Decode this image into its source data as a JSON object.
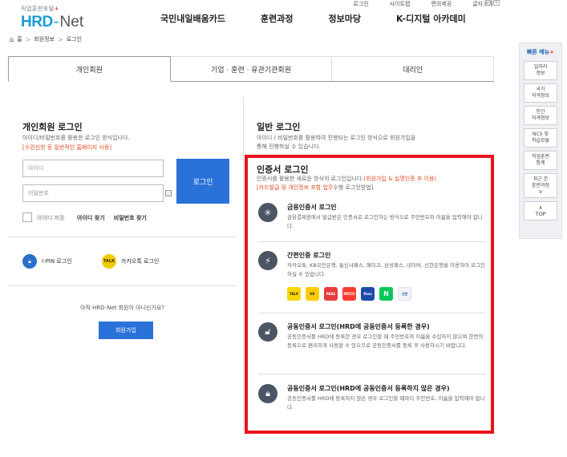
{
  "utility": {
    "links": [
      "로그인",
      "사이트맵",
      "편의제공",
      "글자크기"
    ],
    "font_minus": "-",
    "font_plus": "+"
  },
  "logo": {
    "sub": "직업훈련포털",
    "sub_plus": "+",
    "main_hrd": "HRD",
    "main_dash": "-",
    "main_net": "Net"
  },
  "gnb": [
    "국민내일배움카드",
    "훈련과정",
    "정보마당",
    "K-디지털 아카데미"
  ],
  "breadcrumb": {
    "home": "홈",
    "sep1": ">",
    "level1": "회원정보",
    "sep2": ">",
    "level2": "로그인"
  },
  "tabs": [
    "개인회원",
    "기업 · 훈련 · 유관기관회원",
    "대리인"
  ],
  "personal": {
    "title": "개인회원 로그인",
    "desc": "아이디/비밀번호를 활용한 로그인 방식입니다.",
    "note": "[수강신청 등 일반적인 홈페이지 사용]",
    "id_placeholder": "아이디",
    "pw_placeholder": "비밀번호",
    "login_button": "로그인",
    "save_id": "아이디 저장",
    "find_id": "아이디 찾기",
    "find_sep": "·",
    "find_pw": "비밀번호 찾기",
    "ipin": "I-PIN 로그인",
    "kakao": "카카오톡 로그인",
    "kakao_icon": "TALK",
    "not_member": "아직 HRD-Net 회원이 아니신가요?",
    "join_button": "회원가입"
  },
  "general": {
    "title": "일반 로그인",
    "desc1": "아이디 / 비밀번호를 활용하여 진행되는 로그인 방식으로 회원가입을",
    "desc2": "통해 진행하실 수 있습니다."
  },
  "cert": {
    "title": "인증서 로그인",
    "desc_prefix": "인증서를 활용한 새로운 방식의 로그인입니다.",
    "desc_red1": "(회원가입 & 실명인증 추 이용)",
    "desc_red2": "[카드발급 및 개인정보 포함 업무",
    "desc_suffix": "수행 로그인방법]",
    "items": [
      {
        "title": "금융인증서 로그인",
        "desc": "금융결제원에서 발급받은 인증서로 로그인하는 방식으로 주민번호와 이름을 입력해야 합니다."
      },
      {
        "title": "간편인증 로그인",
        "desc": "카카오톡, KB국민은행, 통신사패스, 페이코, 삼성패스, 네이버, 신한은행을 이용하여 로그인 하실 수 있습니다."
      },
      {
        "title": "공동인증서 로그인(HRD에 공동인증서 등록한 경우)",
        "desc": "공동인증서를 HRD에 등록한 경우 로그인할 때 주민번호와 이름을 수집하지 않으며 한번의 등록으로 편리하게 사용할 수 있으므로 공동인증서를 등록 후 사용하시기 바랍니다."
      },
      {
        "title": "공동인증서 로그인(HRD에 공동인증서 등록하지 않은 경우)",
        "desc": "공동인증서를 HRD에 등록하지 않은 경우 로그인할 때마다 주민번호, 이름을 입력해야 합니다."
      }
    ],
    "apps": [
      {
        "label": "TALK",
        "bg": "#f7d600",
        "fg": "#3c2a00"
      },
      {
        "label": "KB",
        "bg": "#ffcc00",
        "fg": "#333"
      },
      {
        "label": "PASS",
        "bg": "#e83c3c",
        "fg": "#fff"
      },
      {
        "label": "PAYCO",
        "bg": "#ff3b30",
        "fg": "#fff"
      },
      {
        "label": "Pass",
        "bg": "#1c4aa8",
        "fg": "#fff"
      },
      {
        "label": "N",
        "bg": "#03c75a",
        "fg": "#fff"
      },
      {
        "label": "신한",
        "bg": "#f1f4f8",
        "fg": "#1b55b8"
      }
    ]
  },
  "quick_menu": {
    "title": "빠른 메뉴",
    "title_plus": "+",
    "items": [
      [
        "일자리",
        "정보"
      ],
      [
        "국가",
        "자격정보"
      ],
      [
        "민간",
        "자격정보"
      ],
      [
        "NCS 및",
        "학습모듈"
      ],
      [
        "직업훈련",
        "통계"
      ],
      [
        "최근 본",
        "훈련과정"
      ]
    ],
    "arrow": "∨",
    "top_arrow": "∧",
    "top_label": "TOP"
  },
  "colors": {
    "accent": "#2a72d9",
    "highlight_box": "#e9131b",
    "note_red": "#e04e25",
    "logo_blue": "#1a9bd7"
  }
}
